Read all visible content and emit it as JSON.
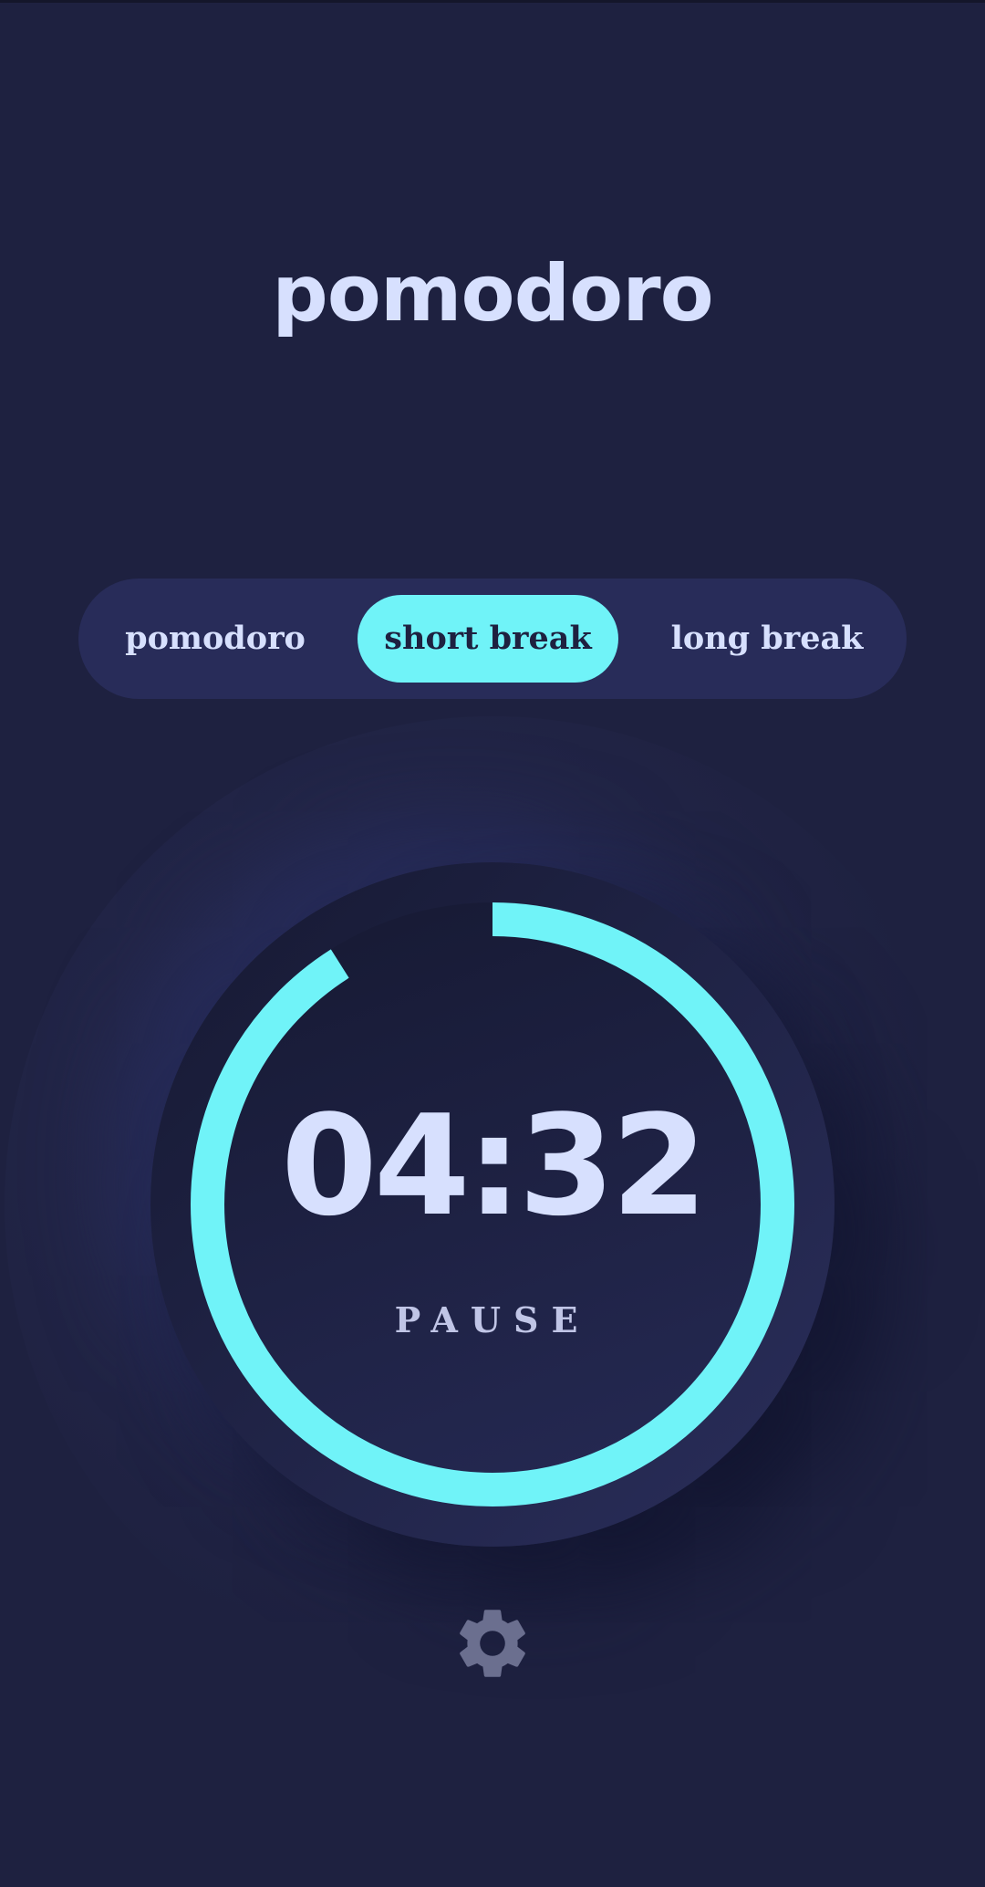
{
  "app": {
    "title": "pomodoro"
  },
  "modes": {
    "items": [
      {
        "label": "pomodoro",
        "active": false
      },
      {
        "label": "short break",
        "active": true
      },
      {
        "label": "long break",
        "active": false
      }
    ]
  },
  "timer": {
    "time": "04:32",
    "action_label": "PAUSE",
    "progress_remaining": 0.91
  },
  "settings": {
    "icon": "gear-icon"
  },
  "colors": {
    "background": "#1e2140",
    "accent": "#70f3f8",
    "text": "#d7e0fe",
    "panel": "#282c59",
    "icon_muted": "#6b6f8f"
  }
}
